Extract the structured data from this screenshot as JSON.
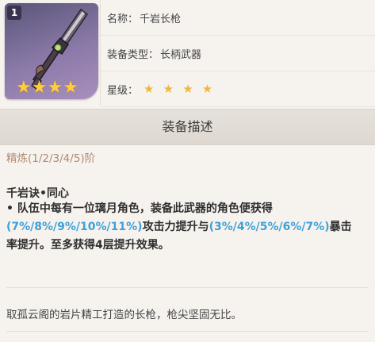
{
  "weapon_card": {
    "rank": "1",
    "stars": [
      "★",
      "★",
      "★",
      "★"
    ],
    "icon": "spear-weapon-icon"
  },
  "info": {
    "name_label": "名称：",
    "name_value": "千岩长枪",
    "type_label": "装备类型：",
    "type_value": "长柄武器",
    "rarity_label": "星级：",
    "rarity_stars": [
      "★",
      "★",
      "★",
      "★"
    ]
  },
  "section": {
    "title": "装备描述"
  },
  "refinement": {
    "label": "精炼(1/2/3/4/5)阶"
  },
  "passive": {
    "name": "千岩诀•同心",
    "line_pre": " • 队伍中每有一位璃月角色，装备此武器的角色便获得",
    "atk_values": "(7%/8%/9%/10%/11%)",
    "line_mid": "攻击力提升与",
    "crit_values": "(3%/4%/5%/6%/7%)",
    "line_post": "暴击率提升。至多获得4层提升效果。"
  },
  "lore": {
    "text": "取孤云阁的岩片精工打造的长枪，枪尖坚固无比。"
  },
  "footer": {
    "text": ""
  },
  "colors": {
    "accent_blue": "#3fa0d8",
    "star_gold": "#f2b63a",
    "refine_brown": "#b08a6e"
  }
}
